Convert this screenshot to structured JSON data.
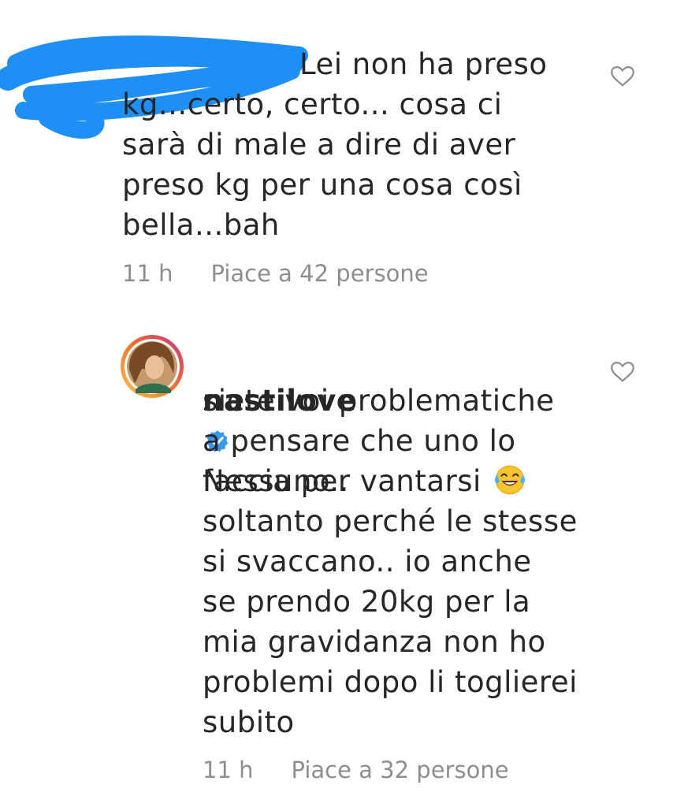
{
  "comments": [
    {
      "username": "",
      "text_line1": "Lei non ha preso",
      "text_rest": "kg...certo, certo... cosa ci\nsarà di male a dire di aver\npreso kg per una cosa così\nbella...bah",
      "time": "11 h",
      "likes": "Piace a 42 persone",
      "username_redacted": true,
      "redaction_color": "#1e8ff5"
    },
    {
      "username": "nastilove",
      "verified": true,
      "text_line1": "Nessuno..",
      "text_line2_to_4": "siete voi problematiche\na pensare che uno lo\nfaccia per vantarsi",
      "emoji": "face-with-tears-of-joy",
      "text_rest": "soltanto perché le stesse\nsi svaccano.. io anche\nse prendo 20kg per la\nmia gravidanza non ho\nproblemi dopo li toglierei\nsubito",
      "time": "11 h",
      "likes": "Piace a 32 persone"
    }
  ],
  "colors": {
    "text": "#262626",
    "meta": "#8e8e8e",
    "verified": "#3897f0",
    "heart_outline": "#8e8e8e"
  }
}
